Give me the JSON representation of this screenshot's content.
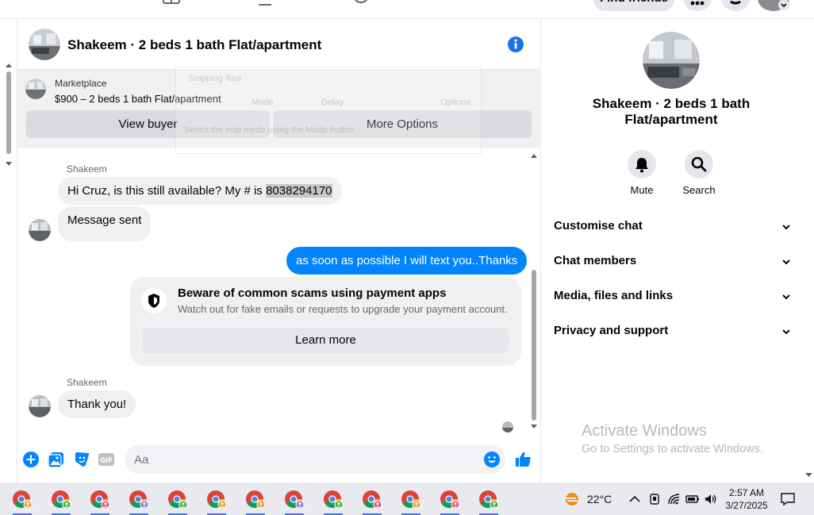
{
  "topnav": {
    "find_friends": "Find friends"
  },
  "chat": {
    "header_title": "Shakeem · 2 beds 1 bath Flat/apartment",
    "marketplace": {
      "source": "Marketplace",
      "listing": "$900 – 2 beds 1 bath Flat/apartment",
      "view_buyer": "View buyer",
      "more_options": "More Options"
    },
    "snipping_overlay": {
      "title": "Snipping Tool",
      "mode": "Mode",
      "delay": "Delay",
      "options": "Options",
      "hint": "Select the snip mode using the Mode button"
    },
    "messages": [
      {
        "sender": "Shakeem",
        "text_prefix": "Hi Cruz, is this still available? My # is ",
        "text_highlight": "8038294170"
      },
      {
        "text": "Message sent"
      },
      {
        "text": "as soon as possible I will text you..Thanks"
      },
      {
        "sender": "Shakeem",
        "text": "Thank you!"
      }
    ],
    "scam_notice": {
      "title": "Beware of common scams using payment apps",
      "body": "Watch out for fake emails or requests to upgrade your payment account.",
      "learn_more": "Learn more"
    },
    "composer": {
      "placeholder": "Aa"
    }
  },
  "right_panel": {
    "title": "Shakeem · 2 beds 1 bath Flat/apartment",
    "actions": [
      {
        "label": "Mute",
        "icon": "bell-icon"
      },
      {
        "label": "Search",
        "icon": "search-icon"
      }
    ],
    "sections": [
      "Customise chat",
      "Chat members",
      "Media, files and links",
      "Privacy and support"
    ]
  },
  "watermark": {
    "line1": "Activate Windows",
    "line2": "Go to Settings to activate Windows."
  },
  "taskbar": {
    "temperature": "22°C",
    "time": "2:57 AM",
    "date": "3/27/2025"
  },
  "colors": {
    "messenger_blue": "#0084ff",
    "accent": "#1b74e4"
  }
}
